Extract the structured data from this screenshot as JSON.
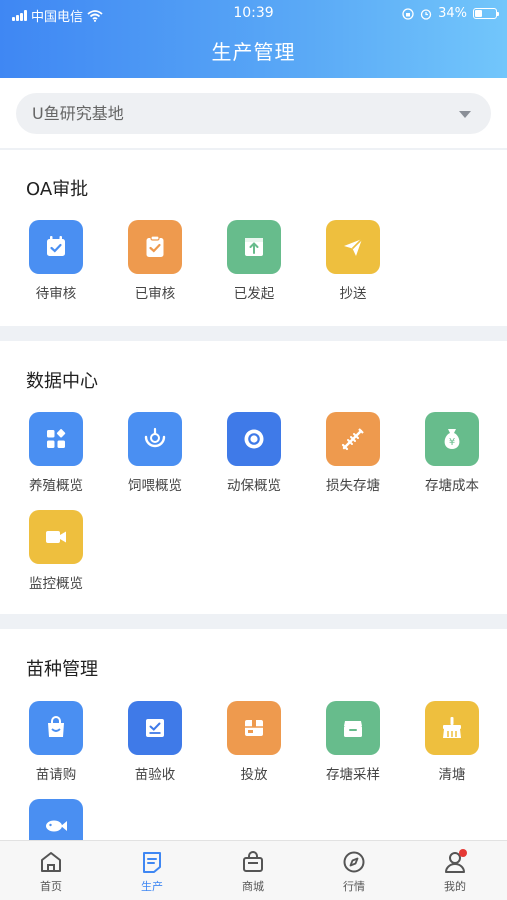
{
  "status_bar": {
    "carrier": "中国电信",
    "time": "10:39",
    "battery": "34%",
    "battery_level": 0.34
  },
  "header": {
    "title": "生产管理"
  },
  "base_selector": {
    "value": "U鱼研究基地"
  },
  "sections": {
    "oa": {
      "title": "OA审批",
      "items": [
        "待审核",
        "已审核",
        "已发起",
        "抄送"
      ]
    },
    "data": {
      "title": "数据中心",
      "items": [
        "养殖概览",
        "饲喂概览",
        "动保概览",
        "损失存塘",
        "存塘成本",
        "监控概览"
      ]
    },
    "seed": {
      "title": "苗种管理",
      "items": [
        "苗请购",
        "苗验收",
        "投放",
        "存塘采样",
        "清塘"
      ]
    }
  },
  "icons": {
    "oa": [
      "calendar-check-icon",
      "clipboard-check-icon",
      "upload-box-icon",
      "paper-plane-icon"
    ],
    "data": [
      "grid-icon",
      "feed-icon",
      "ring-icon",
      "fish-bone-icon",
      "money-bag-icon",
      "video-camera-icon"
    ],
    "seed": [
      "shopping-bag-icon",
      "check-tray-icon",
      "package-icon",
      "storage-box-icon",
      "broom-icon",
      "fish-icon"
    ]
  },
  "colors": {
    "blue": "#4a8ff2",
    "orange": "#ee9a4e",
    "green": "#67bc8c",
    "yellow": "#eebf3e",
    "active_tab": "#3f87f3"
  },
  "tabbar": {
    "items": [
      "首页",
      "生产",
      "商城",
      "行情",
      "我的"
    ],
    "active": "生产"
  }
}
